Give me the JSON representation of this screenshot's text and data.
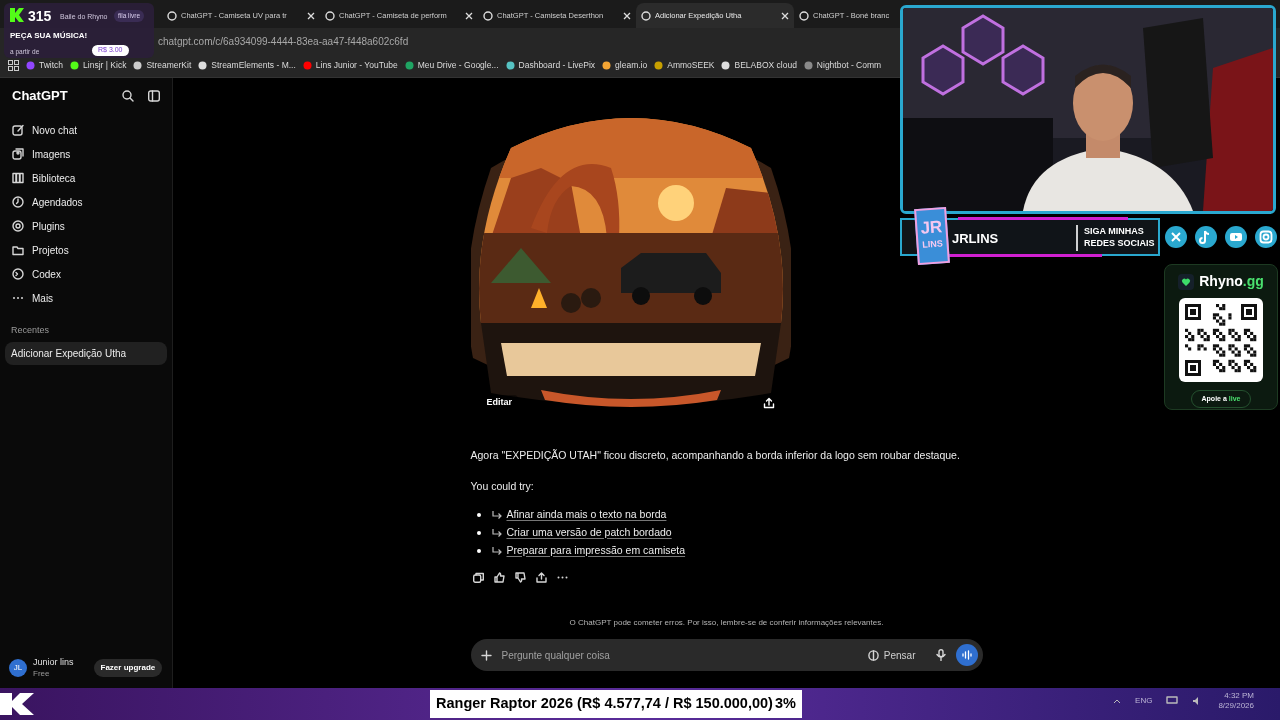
{
  "song_request": {
    "count": "315",
    "title": "Baile do Rhyno",
    "badge": "fila livre",
    "heading": "PEÇA SUA MÚSICA!",
    "price_label": "a partir de",
    "price": "R$ 3.00"
  },
  "browser": {
    "tabs": [
      {
        "title": "ChatGPT - Camiseta UV para tr",
        "selected": false
      },
      {
        "title": "ChatGPT - Camiseta de perform",
        "selected": false
      },
      {
        "title": "ChatGPT - Camiseta Deserthon",
        "selected": false
      },
      {
        "title": "Adicionar Expedição Utha",
        "selected": true
      },
      {
        "title": "ChatGPT - Boné branc",
        "selected": false
      }
    ],
    "address": "chatgpt.com/c/6a934099-4444-83ea-aa47-f448a602c6fd",
    "bookmarks": [
      "Twitch",
      "Linsjr | Kick",
      "StreamerKit",
      "StreamElements - M...",
      "Lins Junior - YouTube",
      "Meu Drive - Google...",
      "Dashboard - LivePix",
      "gleam.io",
      "AmmoSEEK",
      "BELABOX cloud",
      "Nightbot - Comm"
    ]
  },
  "sidebar": {
    "title": "ChatGPT",
    "items": [
      "Novo chat",
      "Imagens",
      "Biblioteca",
      "Agendados",
      "Plugins",
      "Projetos",
      "Codex",
      "Mais"
    ],
    "section": "Recentes",
    "chats": [
      {
        "label": "Adicionar Expedição Utha",
        "selected": true
      }
    ],
    "user": {
      "initials": "JL",
      "name": "Junior lins",
      "plan": "Free"
    },
    "upgrade": "Fazer upgrade"
  },
  "chat": {
    "image_button": "Editar",
    "message": "Agora \"EXPEDIÇÃO UTAH\" ficou discreto, acompanhando a borda inferior da logo sem roubar destaque.",
    "try_label": "You could try:",
    "suggestions": [
      "Afinar ainda mais o texto na borda",
      "Criar uma versão de patch bordado",
      "Preparar para impressão em camiseta"
    ],
    "disclaimer": "O ChatGPT pode cometer erros. Por isso, lembre-se de conferir informações relevantes.",
    "input_placeholder": "Pergunte qualquer coisa",
    "think_button": "Pensar"
  },
  "stream_overlay": {
    "logo": [
      "JR",
      "LINS"
    ],
    "channel": "JRLINS",
    "follow": [
      "SIGA MINHAS",
      "REDES SOCIAIS"
    ],
    "donation": {
      "brand": "Rhyno",
      "brand_suffix": ".gg",
      "button": "Apoie a",
      "button_accent": "live"
    }
  },
  "goal": {
    "text": "Ranger Raptor 2026 (R$ 4.577,74 / R$ 150.000,00)",
    "percent": "3%"
  },
  "taskbar": {
    "language": "ENG",
    "time": "4:32 PM",
    "date": "8/29/2026"
  }
}
